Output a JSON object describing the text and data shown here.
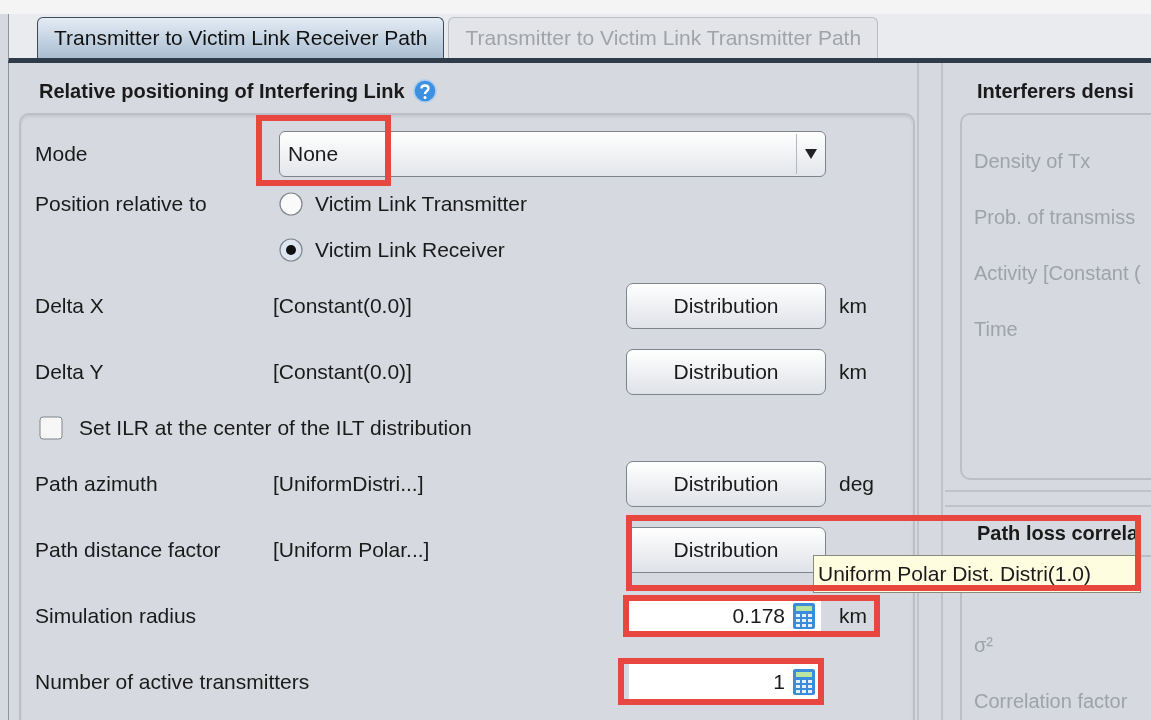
{
  "tabs": [
    {
      "label": "Transmitter to Victim Link Receiver Path",
      "selected": true
    },
    {
      "label": "Transmitter to Victim Link Transmitter Path",
      "selected": false
    }
  ],
  "left_panel": {
    "title": "Relative positioning of Interfering Link",
    "rows": [
      {
        "kind": "combo",
        "label": "Mode",
        "value": "None",
        "highlighted": true
      },
      {
        "kind": "radio",
        "label": "Position relative to",
        "options": [
          {
            "label": "Victim Link Transmitter",
            "selected": false
          },
          {
            "label": "Victim Link Receiver",
            "selected": true
          }
        ]
      },
      {
        "kind": "distribution",
        "label": "Delta X",
        "value": "[Constant(0.0)]",
        "button": "Distribution",
        "unit": "km"
      },
      {
        "kind": "distribution",
        "label": "Delta Y",
        "value": "[Constant(0.0)]",
        "button": "Distribution",
        "unit": "km"
      },
      {
        "kind": "checkbox",
        "label": "Set ILR at the center of the ILT distribution",
        "checked": false
      },
      {
        "kind": "distribution",
        "label": "Path azimuth",
        "value": "[UniformDistri...]",
        "button": "Distribution",
        "unit": "deg"
      },
      {
        "kind": "distribution",
        "label": "Path distance factor",
        "value": "[Uniform Polar...]",
        "button": "Distribution",
        "tooltip": "Uniform Polar Dist. Distri(1.0)",
        "highlighted": true
      },
      {
        "kind": "number",
        "label": "Simulation radius",
        "value": "0.178",
        "unit": "km",
        "highlighted": true
      },
      {
        "kind": "number",
        "label": "Number of active transmitters",
        "value": "1",
        "highlighted": true
      }
    ]
  },
  "right_panels": [
    {
      "title": "Interferers densi",
      "items": [
        "Density of Tx",
        "Prob. of transmiss",
        "Activity [Constant (",
        "Time"
      ]
    },
    {
      "title": "Path loss correla",
      "items": [
        "σ²",
        "Correlation factor"
      ]
    }
  ]
}
